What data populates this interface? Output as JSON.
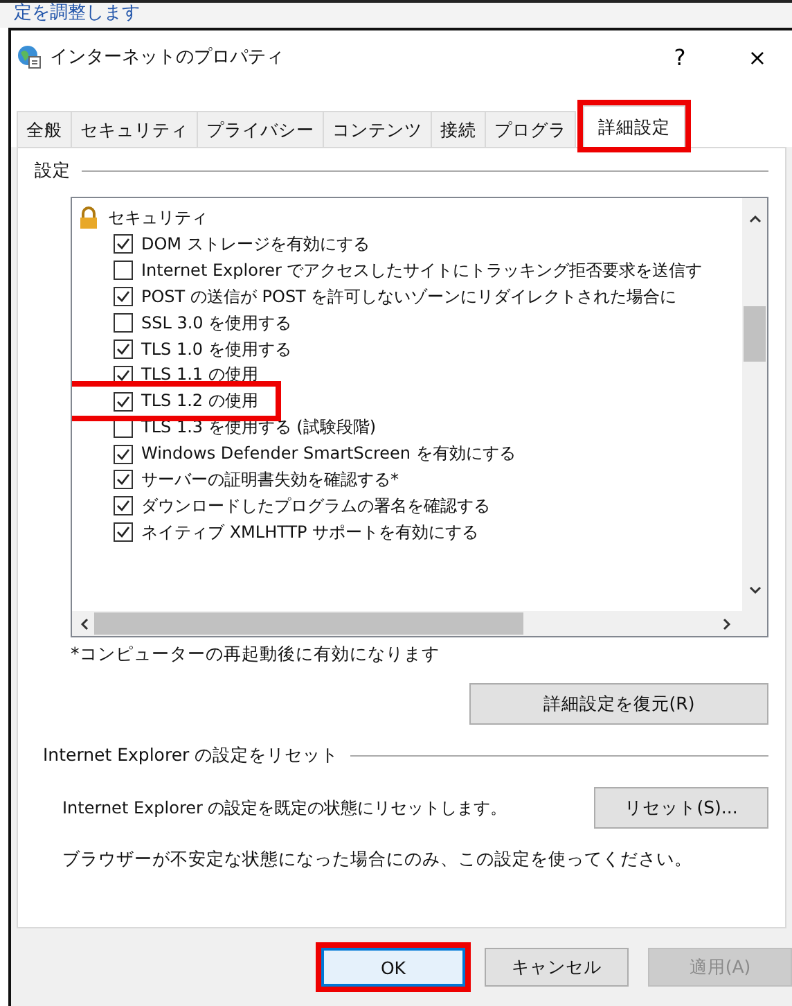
{
  "background_text": "定を調整します",
  "window": {
    "title": "インターネットのプロパティ",
    "help": "?",
    "close": "×"
  },
  "tabs": [
    {
      "label": "全般",
      "selected": false,
      "highlighted": false
    },
    {
      "label": "セキュリティ",
      "selected": false,
      "highlighted": false
    },
    {
      "label": "プライバシー",
      "selected": false,
      "highlighted": false
    },
    {
      "label": "コンテンツ",
      "selected": false,
      "highlighted": false
    },
    {
      "label": "接続",
      "selected": false,
      "highlighted": false
    },
    {
      "label": "プログラ",
      "selected": false,
      "highlighted": false
    },
    {
      "label": "詳細設定",
      "selected": true,
      "highlighted": true
    }
  ],
  "settings_group": "設定",
  "list": {
    "category": "セキュリティ",
    "items": [
      {
        "label": "DOM ストレージを有効にする",
        "checked": true,
        "highlighted": false
      },
      {
        "label": "Internet Explorer でアクセスしたサイトにトラッキング拒否要求を送信す",
        "checked": false,
        "highlighted": false
      },
      {
        "label": "POST の送信が POST を許可しないゾーンにリダイレクトされた場合に",
        "checked": true,
        "highlighted": false
      },
      {
        "label": "SSL 3.0 を使用する",
        "checked": false,
        "highlighted": false
      },
      {
        "label": "TLS 1.0 を使用する",
        "checked": true,
        "highlighted": false
      },
      {
        "label": "TLS 1.1 の使用",
        "checked": true,
        "highlighted": false
      },
      {
        "label": "TLS 1.2 の使用",
        "checked": true,
        "highlighted": true
      },
      {
        "label": "TLS 1.3 を使用する (試験段階)",
        "checked": false,
        "highlighted": false
      },
      {
        "label": "Windows Defender SmartScreen を有効にする",
        "checked": true,
        "highlighted": false
      },
      {
        "label": "サーバーの証明書失効を確認する*",
        "checked": true,
        "highlighted": false
      },
      {
        "label": "ダウンロードしたプログラムの署名を確認する",
        "checked": true,
        "highlighted": false
      },
      {
        "label": "ネイティブ XMLHTTP サポートを有効にする",
        "checked": true,
        "highlighted": false
      }
    ]
  },
  "restart_note": "*コンピューターの再起動後に有効になります",
  "restore_button": "詳細設定を復元(R)",
  "reset_group": "Internet Explorer の設定をリセット",
  "reset_description": "Internet Explorer の設定を既定の状態にリセットします。",
  "reset_button": "リセット(S)...",
  "reset_warning": "ブラウザーが不安定な状態になった場合にのみ、この設定を使ってください。",
  "buttons": [
    {
      "label": "OK",
      "disabled": false,
      "highlighted": true
    },
    {
      "label": "キャンセル",
      "disabled": false,
      "highlighted": false
    },
    {
      "label": "適用(A)",
      "disabled": true,
      "highlighted": false
    }
  ]
}
